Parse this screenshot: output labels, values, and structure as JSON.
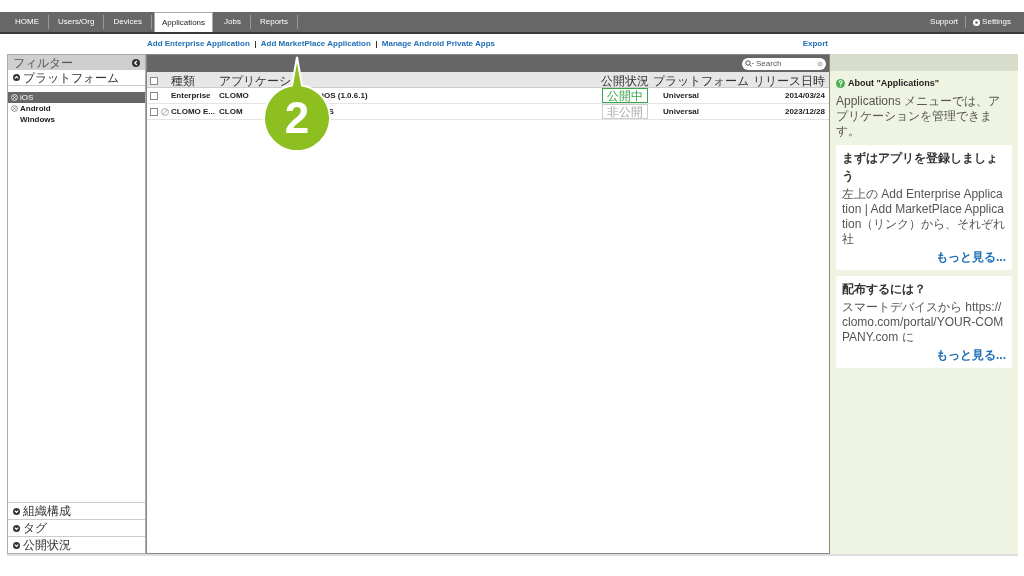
{
  "nav": {
    "tabs": [
      {
        "label": "HOME",
        "selected": false
      },
      {
        "label": "Users/Org",
        "selected": false
      },
      {
        "label": "Devices",
        "selected": false
      },
      {
        "label": "Applications",
        "selected": true
      },
      {
        "label": "Jobs",
        "selected": false
      },
      {
        "label": "Reports",
        "selected": false
      }
    ],
    "right": [
      {
        "label": "Support",
        "icon": false
      },
      {
        "label": "Settings",
        "icon": true
      }
    ]
  },
  "links": [
    "Add Enterprise Application",
    "Add MarketPlace Application",
    "Manage Android Private Apps"
  ],
  "export": "Export",
  "sidebar": {
    "title": "フィルター",
    "section": {
      "label": "プラットフォーム",
      "expanded": true
    },
    "items": [
      {
        "label": "iOS",
        "selected": true,
        "marked": true
      },
      {
        "label": "Android",
        "selected": false,
        "marked": true
      },
      {
        "label": "Windows",
        "selected": false,
        "marked": false
      }
    ],
    "bottom_sections": [
      {
        "label": "組織構成",
        "expanded": false
      },
      {
        "label": "タグ",
        "expanded": false
      },
      {
        "label": "公開状況",
        "expanded": false
      }
    ]
  },
  "search": {
    "placeholder": "Search"
  },
  "table": {
    "all_checked": false,
    "columns": [
      "種類",
      "アプリケーシ",
      "公開状況",
      "プラットフォーム",
      "リリース日時"
    ],
    "rows": [
      {
        "checked": false,
        "blocked": false,
        "type": "Enterprise",
        "app": [
          "CLOMO",
          "iOS (1.0.6.1)"
        ],
        "status": {
          "label": "公開中",
          "kind": "published"
        },
        "platform": "Universal",
        "date": "2014/03/24"
      },
      {
        "checked": false,
        "blocked": true,
        "type": "CLOMO E...",
        "app": [
          "CLOM",
          "S"
        ],
        "status": {
          "label": "非公開",
          "kind": "unpublished"
        },
        "platform": "Universal",
        "date": "2023/12/28"
      }
    ]
  },
  "about": {
    "title": "About \"Applications\"",
    "text": "Applications メニューでは、アプリケーションを管理できます。",
    "cards": [
      {
        "title": "まずはアプリを登録しましょう",
        "text": "左上の Add Enterprise Application | Add MarketPlace Application（リンク）から、それぞれ社",
        "more": "もっと見る..."
      },
      {
        "title": "配布するには？",
        "text": "スマートデバイスから https://clomo.com/portal/YOUR-COMPANY.com に",
        "more": "もっと見る..."
      }
    ]
  },
  "callout": "2"
}
